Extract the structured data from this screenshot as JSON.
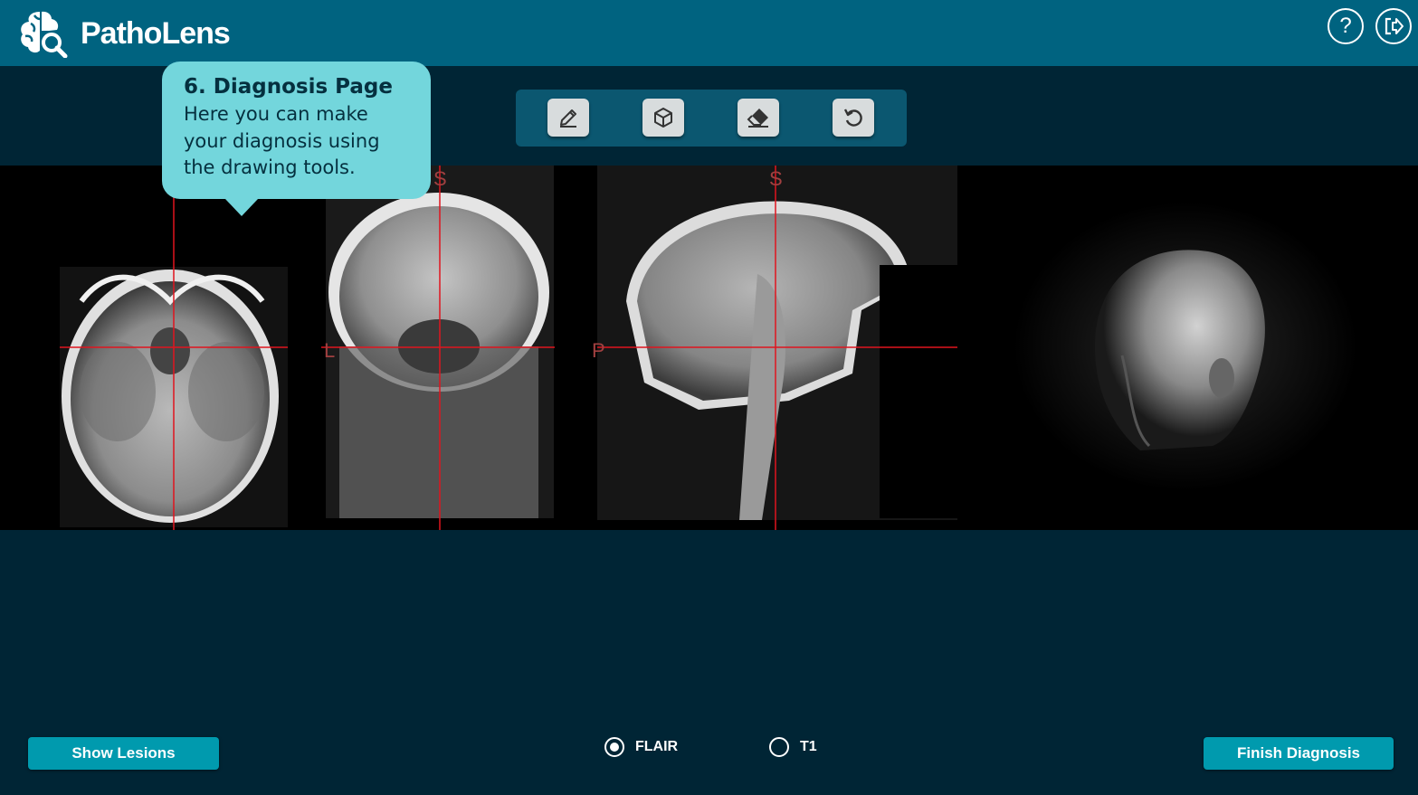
{
  "header": {
    "app_name": "PathoLens",
    "logo_icon": "brain-search-icon",
    "help_icon": "help-icon",
    "help_glyph": "?",
    "logout_icon": "logout-icon"
  },
  "toolbar": {
    "tools": [
      {
        "name": "pencil",
        "icon": "pencil-icon"
      },
      {
        "name": "3d-box",
        "icon": "cube-icon"
      },
      {
        "name": "eraser",
        "icon": "eraser-icon"
      },
      {
        "name": "undo",
        "icon": "undo-icon"
      }
    ]
  },
  "tooltip": {
    "title": "6. Diagnosis Page",
    "body": "Here you can make your diagnosis using the drawing tools."
  },
  "viewer": {
    "coronal": {
      "top_label": "S",
      "left_label": "L"
    },
    "sagittal": {
      "top_label": "S",
      "left_label": "P"
    },
    "crosshair_color": "#e0141e",
    "orientation_label_color": "#a14040"
  },
  "sequence": {
    "options": [
      {
        "label": "FLAIR",
        "selected": true
      },
      {
        "label": "T1",
        "selected": false
      }
    ]
  },
  "actions": {
    "show_lesions": "Show Lesions",
    "finish_diagnosis": "Finish Diagnosis"
  },
  "colors": {
    "topbar": "#006380",
    "background": "#002535",
    "toolbar": "#0b5770",
    "tooltip": "#73d6dc",
    "button": "#009aae"
  }
}
